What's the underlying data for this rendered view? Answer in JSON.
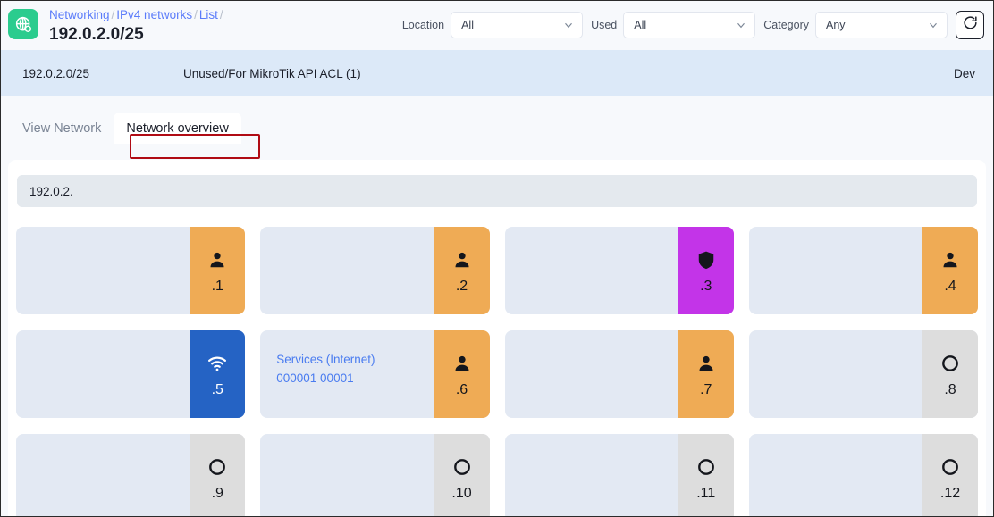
{
  "header": {
    "logo_icon": "globe-icon",
    "breadcrumb": [
      {
        "label": "Networking",
        "link": true
      },
      {
        "label": "IPv4 networks",
        "link": true
      },
      {
        "label": "List",
        "link": true
      }
    ],
    "breadcrumb_separator": "/",
    "page_title": "192.0.2.0/25",
    "filters": [
      {
        "label": "Location",
        "value": "All",
        "name": "location"
      },
      {
        "label": "Used",
        "value": "All",
        "name": "used"
      },
      {
        "label": "Category",
        "value": "Any",
        "name": "category"
      }
    ],
    "refresh_icon": "refresh-icon"
  },
  "info_bar": {
    "cidr": "192.0.2.0/25",
    "description": "Unused/For MikroTik API ACL (1)",
    "environment": "Dev",
    "background": "#dce9f8"
  },
  "tabs": [
    {
      "label": "View Network",
      "active": false,
      "name": "view-network"
    },
    {
      "label": "Network overview",
      "active": true,
      "name": "network-overview"
    }
  ],
  "tab_highlight_color": "#b00b14",
  "subnet": {
    "prefix_label": "192.0.2."
  },
  "colors": {
    "user_badge": "#efab55",
    "shield_badge": "#c334e8",
    "wifi_badge": "#2563c4",
    "free_badge": "#dddddd",
    "cell_background": "#e3e9f3",
    "link": "#4a7cf0",
    "brand": "#2bcc8e"
  },
  "ip_cells": [
    {
      "num": ".1",
      "icon": "user-icon",
      "badge": "user",
      "lines": []
    },
    {
      "num": ".2",
      "icon": "user-icon",
      "badge": "user",
      "lines": []
    },
    {
      "num": ".3",
      "icon": "shield-icon",
      "badge": "shield",
      "lines": []
    },
    {
      "num": ".4",
      "icon": "user-icon",
      "badge": "user",
      "lines": []
    },
    {
      "num": ".5",
      "icon": "wifi-icon",
      "badge": "wifi",
      "lines": []
    },
    {
      "num": ".6",
      "icon": "user-icon",
      "badge": "user",
      "lines": [
        "Services (Internet)",
        "000001 00001"
      ]
    },
    {
      "num": ".7",
      "icon": "user-icon",
      "badge": "user",
      "lines": []
    },
    {
      "num": ".8",
      "icon": "circle-icon",
      "badge": "free",
      "lines": []
    },
    {
      "num": ".9",
      "icon": "circle-icon",
      "badge": "free",
      "lines": []
    },
    {
      "num": ".10",
      "icon": "circle-icon",
      "badge": "free",
      "lines": []
    },
    {
      "num": ".11",
      "icon": "circle-icon",
      "badge": "free",
      "lines": []
    },
    {
      "num": ".12",
      "icon": "circle-icon",
      "badge": "free",
      "lines": []
    }
  ]
}
